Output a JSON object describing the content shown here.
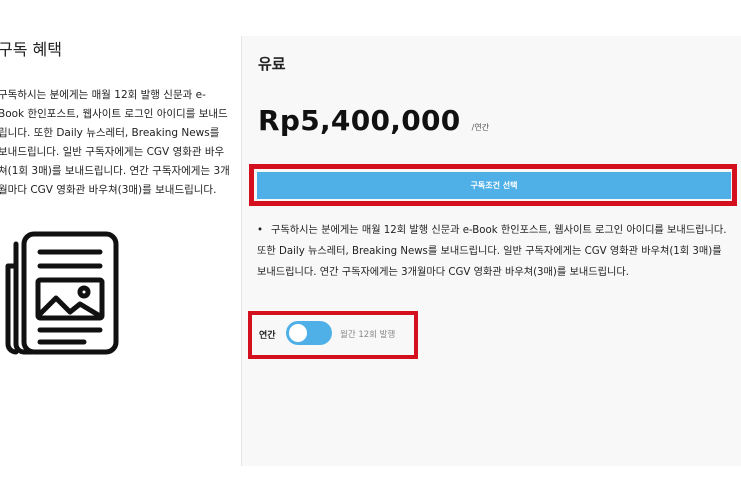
{
  "benefits": {
    "title": "구독 혜택",
    "lines": [
      "구독하시는 분에게는 매월 12회 발행 신문과 e-",
      "Book 한인포스트, 웹사이트 로그인 아이디를 보내드",
      "립니다. 또한 Daily 뉴스레터, Breaking News를",
      "보내드립니다. 일반 구독자에게는 CGV 영화관 바우",
      "쳐(1회 3매)를 보내드립니다. 연간 구독자에게는 3개",
      "월마다 CGV 영화관 바우쳐(3매)를 보내드립니다."
    ],
    "icon": "newspaper-icon"
  },
  "plan": {
    "name": "유료",
    "price": "Rp5,400,000",
    "price_unit": "/연간",
    "select_label": "구독조건 선택",
    "description_lines": [
      "구독하시는 분에게는 매월 12회 발행 신문과 e-Book 한인포스트, 웹사이트 로그인 아이디를 보내드립니다.",
      "또한 Daily 뉴스레터, Breaking News를 보내드립니다. 일반 구독자에게는 CGV 영화관 바우쳐(1회 3매)를",
      "보내드립니다. 연간 구독자에게는 3개월마다 CGV 영화관 바우쳐(3매)를 보내드립니다."
    ],
    "bullet": "•"
  },
  "billing_toggle": {
    "left_label": "연간",
    "right_label": "월간 12회 발행"
  },
  "colors": {
    "accent": "#4fb0e8",
    "highlight": "#d40f1e",
    "panel_bg": "#f8f8f8"
  }
}
